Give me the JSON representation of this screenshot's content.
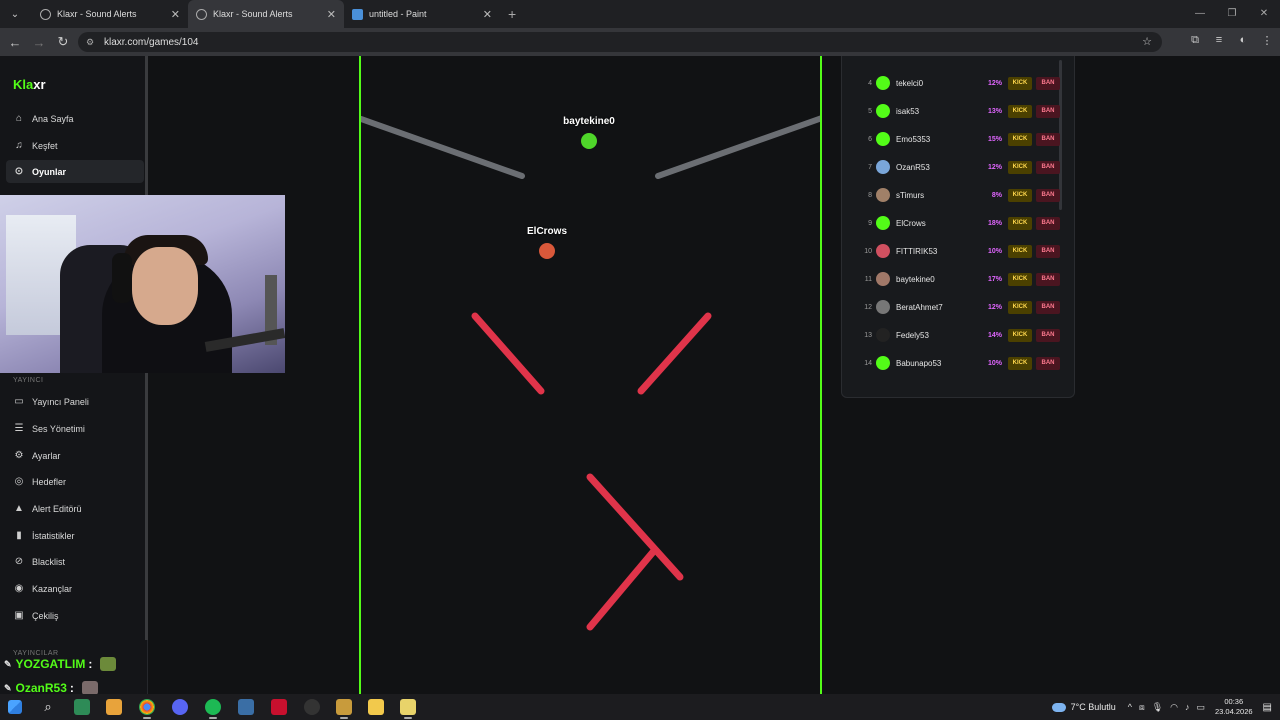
{
  "browser": {
    "tabs": [
      {
        "title": "Klaxr - Sound Alerts",
        "active": false
      },
      {
        "title": "Klaxr - Sound Alerts",
        "active": true
      },
      {
        "title": "untitled - Paint",
        "active": false
      }
    ],
    "url": "klaxr.com/games/104"
  },
  "sidebar": {
    "logo": {
      "part1": "Kla",
      "part2": "xr"
    },
    "nav": [
      {
        "label": "Ana Sayfa",
        "icon": "home-icon"
      },
      {
        "label": "Keşfet",
        "icon": "music-note-icon"
      },
      {
        "label": "Oyunlar",
        "icon": "gamepad-icon",
        "active": true
      }
    ],
    "section_streamer": "YAYINCI",
    "streamer_nav": [
      {
        "label": "Yayıncı Paneli",
        "icon": "monitor-icon"
      },
      {
        "label": "Ses Yönetimi",
        "icon": "list-icon"
      },
      {
        "label": "Ayarlar",
        "icon": "gear-icon"
      },
      {
        "label": "Hedefler",
        "icon": "target-icon"
      },
      {
        "label": "Alert Editörü",
        "icon": "bell-icon"
      },
      {
        "label": "İstatistikler",
        "icon": "bar-chart-icon"
      },
      {
        "label": "Blacklist",
        "icon": "block-icon"
      },
      {
        "label": "Kazançlar",
        "icon": "coins-icon"
      },
      {
        "label": "Çekiliş",
        "icon": "gift-icon"
      }
    ],
    "section_streamers": "YAYINCILAR"
  },
  "chat": [
    {
      "user": "YOZGATLIM",
      "colon": ":"
    },
    {
      "user": "OzanR53",
      "colon": ":"
    }
  ],
  "game": {
    "balls": [
      {
        "label": "baytekine0",
        "color": "#4fd62a"
      },
      {
        "label": "ElCrows",
        "color": "#d9583a"
      }
    ],
    "accent": "#53fc18",
    "obstacle_color": "#e0344a",
    "funnel_color": "#6b6e73"
  },
  "leaderboard": {
    "rows": [
      {
        "rank": "4",
        "name": "tekelci0",
        "pct": "12%"
      },
      {
        "rank": "5",
        "name": "isak53",
        "pct": "13%"
      },
      {
        "rank": "6",
        "name": "Emo5353",
        "pct": "15%"
      },
      {
        "rank": "7",
        "name": "OzanR53",
        "pct": "12%"
      },
      {
        "rank": "8",
        "name": "sTimurs",
        "pct": "8%"
      },
      {
        "rank": "9",
        "name": "ElCrows",
        "pct": "18%"
      },
      {
        "rank": "10",
        "name": "FITTIRIK53",
        "pct": "10%"
      },
      {
        "rank": "11",
        "name": "baytekine0",
        "pct": "17%"
      },
      {
        "rank": "12",
        "name": "BeratAhmet7",
        "pct": "12%"
      },
      {
        "rank": "13",
        "name": "Fedely53",
        "pct": "14%"
      },
      {
        "rank": "14",
        "name": "Babunapo53",
        "pct": "10%"
      }
    ],
    "kick_label": "KICK",
    "ban_label": "BAN"
  },
  "taskbar": {
    "weather": "7°C Bulutlu",
    "time": "00:36",
    "date": "23.04.2026"
  }
}
